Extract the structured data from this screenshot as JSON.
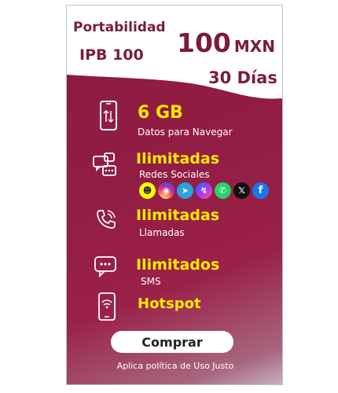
{
  "header": {
    "portability_label": "Portabilidad",
    "plan_name": "IPB 100",
    "price_amount": "100",
    "price_currency": "MXN",
    "duration": "30 Días"
  },
  "features": [
    {
      "title": "6 GB",
      "subtitle": "Datos para Navegar",
      "icon": "smartphone-data-icon"
    },
    {
      "title": "Ilimitadas",
      "subtitle": "Redes Sociales",
      "icon": "social-chat-icon"
    },
    {
      "title": "Ilimitadas",
      "subtitle": "Llamadas",
      "icon": "phone-call-icon"
    },
    {
      "title": "Ilimitados",
      "subtitle": "SMS",
      "icon": "sms-bubble-icon"
    },
    {
      "title": "Hotspot",
      "subtitle": "",
      "icon": "hotspot-phone-icon"
    }
  ],
  "social_apps": [
    "snapchat-icon",
    "instagram-icon",
    "telegram-icon",
    "messenger-icon",
    "whatsapp-icon",
    "x-icon",
    "facebook-icon"
  ],
  "cta": {
    "label": "Comprar"
  },
  "footer": {
    "text": "Aplica política de Uso Justo"
  },
  "colors": {
    "primary": "#931d44",
    "accent": "#ffea00",
    "text_dark": "#7a1b3a"
  }
}
